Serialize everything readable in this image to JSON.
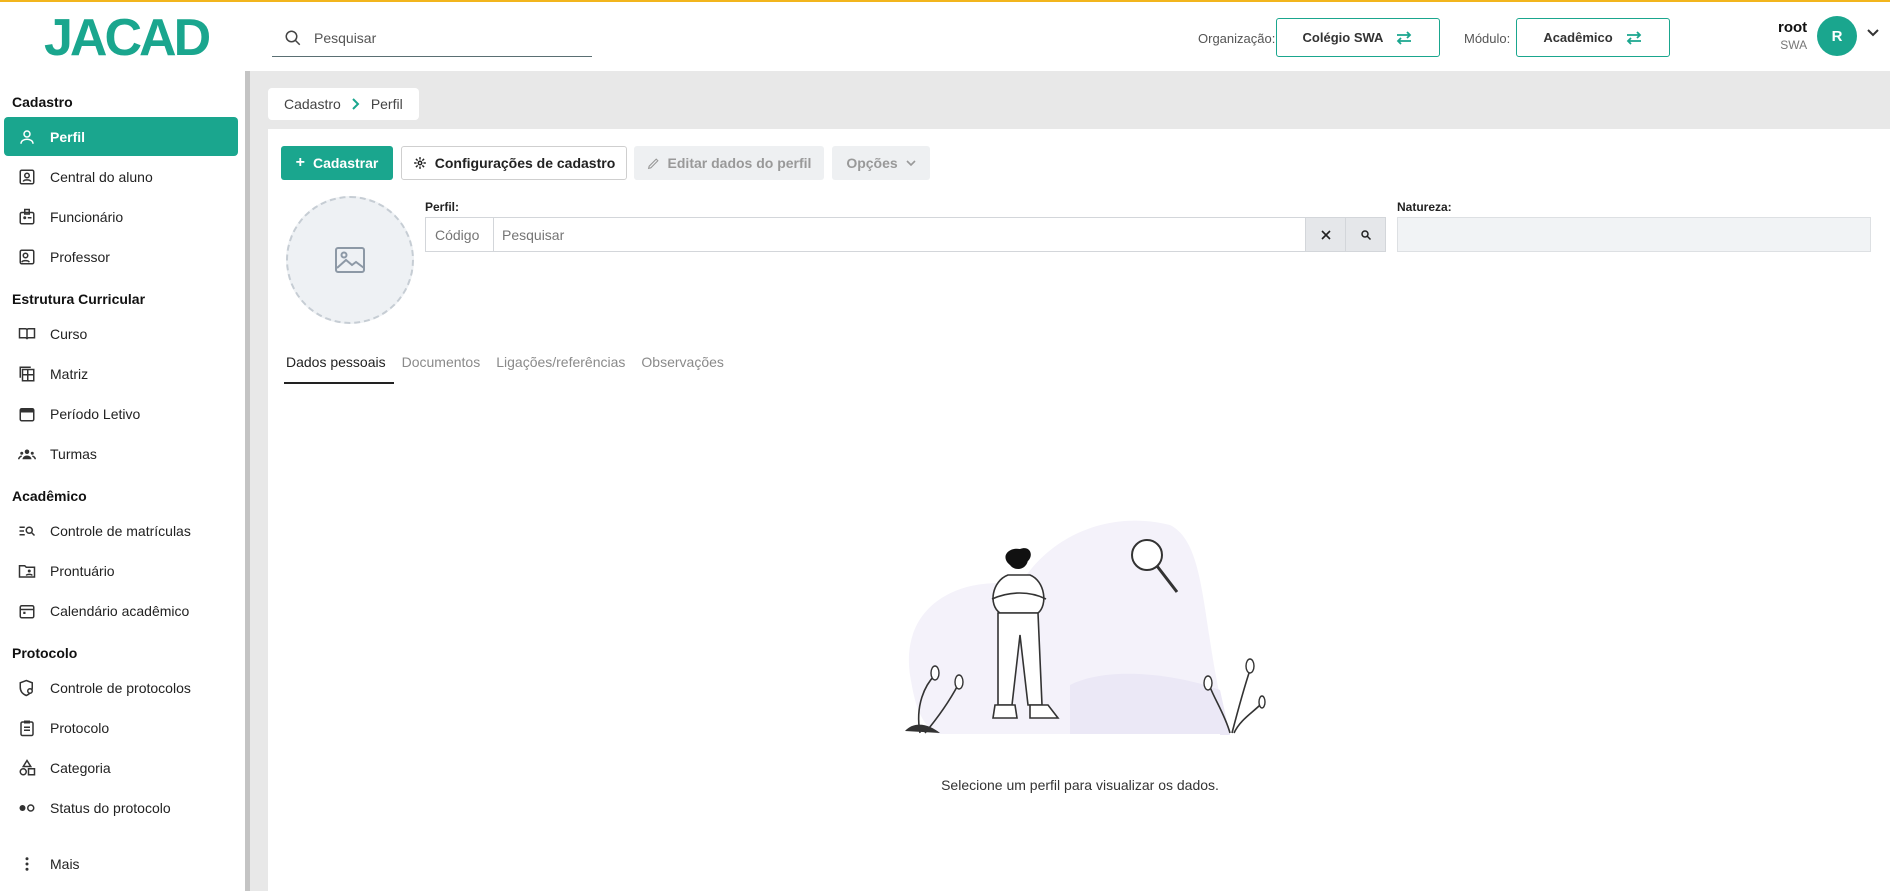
{
  "app": {
    "logo": "JACAD"
  },
  "header": {
    "search_placeholder": "Pesquisar",
    "org_label": "Organização:",
    "org_value": "Colégio SWA",
    "module_label": "Módulo:",
    "module_value": "Acadêmico",
    "user_name": "root",
    "user_org": "SWA",
    "avatar_initial": "R"
  },
  "sidebar": {
    "sections": [
      {
        "title": "Cadastro",
        "items": [
          "Perfil",
          "Central do aluno",
          "Funcionário",
          "Professor"
        ]
      },
      {
        "title": "Estrutura Curricular",
        "items": [
          "Curso",
          "Matriz",
          "Período Letivo",
          "Turmas"
        ]
      },
      {
        "title": "Acadêmico",
        "items": [
          "Controle de matrículas",
          "Prontuário",
          "Calendário acadêmico"
        ]
      },
      {
        "title": "Protocolo",
        "items": [
          "Controle de protocolos",
          "Protocolo",
          "Categoria",
          "Status do protocolo"
        ]
      }
    ],
    "more": "Mais",
    "active_item": "Perfil"
  },
  "breadcrumb": {
    "root": "Cadastro",
    "current": "Perfil"
  },
  "toolbar": {
    "create": "Cadastrar",
    "config": "Configurações de cadastro",
    "edit": "Editar dados do perfil",
    "options": "Opções"
  },
  "form": {
    "perfil_label": "Perfil:",
    "code_placeholder": "Código",
    "search_placeholder": "Pesquisar",
    "natureza_label": "Natureza:",
    "natureza_value": ""
  },
  "tabs": [
    "Dados pessoais",
    "Documentos",
    "Ligações/referências",
    "Observações"
  ],
  "active_tab": "Dados pessoais",
  "empty_message": "Selecione um perfil para visualizar os dados.",
  "colors": {
    "accent": "#1aa68e",
    "topline": "#f2b51d"
  }
}
